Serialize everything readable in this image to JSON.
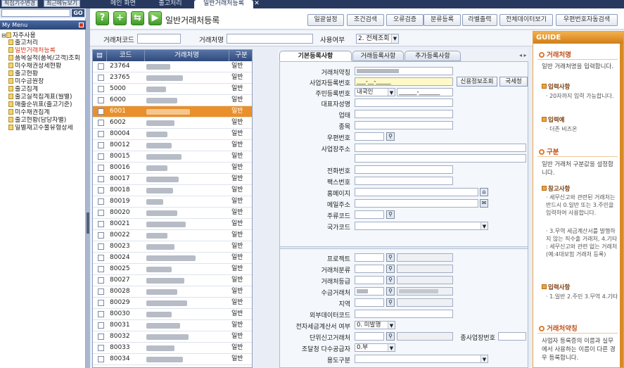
{
  "topbar": {
    "btn1": "직접기수변경",
    "btn2": "최근메뉴보기",
    "tabs": [
      "메인 화면",
      "출고처리",
      "일반거래처등록"
    ]
  },
  "sidebar": {
    "go": "GO",
    "mymenu": "My Menu",
    "root": "자주사용",
    "items": [
      "출고처리",
      "일반거래처등록",
      "품목실적(품목/고객)조회",
      "미수채권상세현황",
      "출고현황",
      "미수금원장",
      "출고집계",
      "출고실적집계표(월별)",
      "매출순위표(출고기준)",
      "미수채권집계",
      "출고현황(담당자별)",
      "일별재고수불유형상세"
    ]
  },
  "toolbar": {
    "icons": [
      "?",
      "+",
      "⇆",
      "▶"
    ],
    "title": "일반거래처등록",
    "buttons": [
      "일괄설정",
      "조건검색",
      "오류검증",
      "분류등록",
      "라벨출력",
      "전체데이터보기",
      "우편번호자동검색"
    ]
  },
  "filter": {
    "code_label": "거래처코드",
    "name_label": "거래처명",
    "usage_label": "사용여부",
    "usage_value": "2. 전체조회"
  },
  "grid": {
    "headers": [
      "코드",
      "거래처명",
      "구분"
    ],
    "rows": [
      {
        "code": "23764",
        "type": "일반"
      },
      {
        "code": "23765",
        "type": "일반"
      },
      {
        "code": "5000",
        "type": "일반"
      },
      {
        "code": "6000",
        "type": "일반"
      },
      {
        "code": "6001",
        "type": "일반"
      },
      {
        "code": "6002",
        "type": "일반"
      },
      {
        "code": "80004",
        "type": "일반"
      },
      {
        "code": "80012",
        "type": "일반"
      },
      {
        "code": "80015",
        "type": "일반"
      },
      {
        "code": "80016",
        "type": "일반"
      },
      {
        "code": "80017",
        "type": "일반"
      },
      {
        "code": "80018",
        "type": "일반"
      },
      {
        "code": "80019",
        "type": "일반"
      },
      {
        "code": "80020",
        "type": "일반"
      },
      {
        "code": "80021",
        "type": "일반"
      },
      {
        "code": "80022",
        "type": "일반"
      },
      {
        "code": "80023",
        "type": "일반"
      },
      {
        "code": "80024",
        "type": "일반"
      },
      {
        "code": "80025",
        "type": "일반"
      },
      {
        "code": "80027",
        "type": "일반"
      },
      {
        "code": "80028",
        "type": "일반"
      },
      {
        "code": "80029",
        "type": "일반"
      },
      {
        "code": "80030",
        "type": "일반"
      },
      {
        "code": "80031",
        "type": "일반"
      },
      {
        "code": "80032",
        "type": "일반"
      },
      {
        "code": "80033",
        "type": "일반"
      },
      {
        "code": "80034",
        "type": "일반"
      }
    ],
    "selected_index": 4
  },
  "detail": {
    "tabs": [
      "기본등록사항",
      "거래등록사항",
      "추가등록사항"
    ],
    "labels": {
      "trade_name": "거래처약칭",
      "biz_no": "사업자등록번호",
      "resident_no": "주민등록번호",
      "ceo": "대표자성명",
      "biz_type": "업태",
      "biz_item": "종목",
      "zip": "우편번호",
      "address": "사업장주소",
      "phone": "전화번호",
      "fax": "팩스번호",
      "homepage": "홈페이지",
      "email": "메일주소",
      "main_code": "주류코드",
      "country": "국가코드",
      "project": "프로젝트",
      "category": "거래처분류",
      "grade": "거래처등급",
      "payee": "수금거래처",
      "region": "지역",
      "external_code": "외부데이터코드",
      "einvoice": "전자세금계산서 여부",
      "unit_report": "단위신고거래처",
      "sub_biz_no": "종사업장번호",
      "multi_supplier": "조달청 다수공급자",
      "purpose": "용도구분"
    },
    "biz_no_value": "___-__-_____",
    "resident_option": "내국인",
    "resident_value": "______-_______",
    "credit_btn": "신용정보조회",
    "tax_btn": "국세청",
    "einvoice_value": "0. 미발행",
    "multi_supplier_value": "0.부"
  },
  "guide": {
    "title": "GUIDE",
    "s1_title": "거래처명",
    "s1_text": "일반 거래처명을 입력합니다.",
    "s1_sub1": "입력사항",
    "s1_sub1_text": "· 20자까지 입력 가능합니다.",
    "s1_sub2": "입력예",
    "s1_sub2_text": "· 더존 비즈온",
    "s2_title": "구분",
    "s2_text": "일반 거래처 구분값을 설정합니다.",
    "s2_sub1": "참고사항",
    "s2_sub1_text1": "· 세무신고와 관련된 거래처는 반드시 0.일반 또는 3.주민을 입력하여 사용합니다.",
    "s2_sub1_text2": "· 3.무역 세금계산서를 발행하지 않는 직수출 거래처, 4.기타 : 세무신고와 관련 없는 거래처(예:4대보험 거래처 등록)",
    "s2_sub2": "입력사항",
    "s2_sub2_text": "· 1.일반 2.주민 3.무역 4.기타",
    "s3_title": "거래처약칭",
    "s3_text": "사업자 등록증의 이름과 실무에서 사용하는 이름이 다른 경우 등록합니다."
  }
}
